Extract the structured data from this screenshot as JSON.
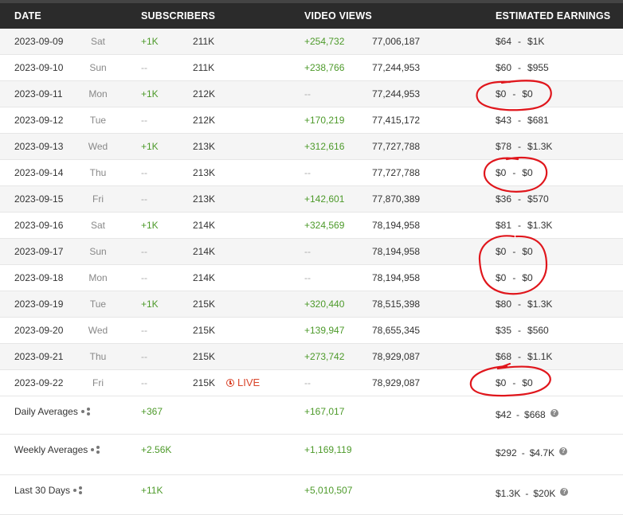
{
  "header": {
    "date": "DATE",
    "subscribers": "SUBSCRIBERS",
    "video_views": "VIDEO VIEWS",
    "earnings": "ESTIMATED EARNINGS"
  },
  "rows": [
    {
      "date": "2023-09-09",
      "day": "Sat",
      "sub_change": "+1K",
      "subs": "211K",
      "view_change": "+254,732",
      "views": "77,006,187",
      "earn_low": "$64",
      "earn_high": "$1K"
    },
    {
      "date": "2023-09-10",
      "day": "Sun",
      "sub_change": "--",
      "subs": "211K",
      "view_change": "+238,766",
      "views": "77,244,953",
      "earn_low": "$60",
      "earn_high": "$955"
    },
    {
      "date": "2023-09-11",
      "day": "Mon",
      "sub_change": "+1K",
      "subs": "212K",
      "view_change": "--",
      "views": "77,244,953",
      "earn_low": "$0",
      "earn_high": "$0"
    },
    {
      "date": "2023-09-12",
      "day": "Tue",
      "sub_change": "--",
      "subs": "212K",
      "view_change": "+170,219",
      "views": "77,415,172",
      "earn_low": "$43",
      "earn_high": "$681"
    },
    {
      "date": "2023-09-13",
      "day": "Wed",
      "sub_change": "+1K",
      "subs": "213K",
      "view_change": "+312,616",
      "views": "77,727,788",
      "earn_low": "$78",
      "earn_high": "$1.3K"
    },
    {
      "date": "2023-09-14",
      "day": "Thu",
      "sub_change": "--",
      "subs": "213K",
      "view_change": "--",
      "views": "77,727,788",
      "earn_low": "$0",
      "earn_high": "$0"
    },
    {
      "date": "2023-09-15",
      "day": "Fri",
      "sub_change": "--",
      "subs": "213K",
      "view_change": "+142,601",
      "views": "77,870,389",
      "earn_low": "$36",
      "earn_high": "$570"
    },
    {
      "date": "2023-09-16",
      "day": "Sat",
      "sub_change": "+1K",
      "subs": "214K",
      "view_change": "+324,569",
      "views": "78,194,958",
      "earn_low": "$81",
      "earn_high": "$1.3K"
    },
    {
      "date": "2023-09-17",
      "day": "Sun",
      "sub_change": "--",
      "subs": "214K",
      "view_change": "--",
      "views": "78,194,958",
      "earn_low": "$0",
      "earn_high": "$0"
    },
    {
      "date": "2023-09-18",
      "day": "Mon",
      "sub_change": "--",
      "subs": "214K",
      "view_change": "--",
      "views": "78,194,958",
      "earn_low": "$0",
      "earn_high": "$0"
    },
    {
      "date": "2023-09-19",
      "day": "Tue",
      "sub_change": "+1K",
      "subs": "215K",
      "view_change": "+320,440",
      "views": "78,515,398",
      "earn_low": "$80",
      "earn_high": "$1.3K"
    },
    {
      "date": "2023-09-20",
      "day": "Wed",
      "sub_change": "--",
      "subs": "215K",
      "view_change": "+139,947",
      "views": "78,655,345",
      "earn_low": "$35",
      "earn_high": "$560"
    },
    {
      "date": "2023-09-21",
      "day": "Thu",
      "sub_change": "--",
      "subs": "215K",
      "view_change": "+273,742",
      "views": "78,929,087",
      "earn_low": "$68",
      "earn_high": "$1.1K"
    },
    {
      "date": "2023-09-22",
      "day": "Fri",
      "sub_change": "--",
      "subs": "215K",
      "live": "LIVE",
      "view_change": "--",
      "views": "78,929,087",
      "earn_low": "$0",
      "earn_high": "$0"
    }
  ],
  "averages": [
    {
      "label": "Daily Averages",
      "subs": "+367",
      "views": "+167,017",
      "earn_low": "$42",
      "earn_high": "$668",
      "help": "?"
    },
    {
      "label": "Weekly Averages",
      "subs": "+2.56K",
      "views": "+1,169,119",
      "earn_low": "$292",
      "earn_high": "$4.7K",
      "help": "?"
    },
    {
      "label": "Last 30 Days",
      "subs": "+11K",
      "views": "+5,010,507",
      "earn_low": "$1.3K",
      "earn_high": "$20K",
      "help": "?"
    }
  ],
  "colors": {
    "header_bg": "#2b2b2b",
    "positive": "#4d9a2a",
    "live": "#d9452b",
    "annotation": "#e0161c"
  },
  "icons": {
    "share": "share-icon",
    "help": "help-icon",
    "live": "clock-icon"
  },
  "separator": "-"
}
